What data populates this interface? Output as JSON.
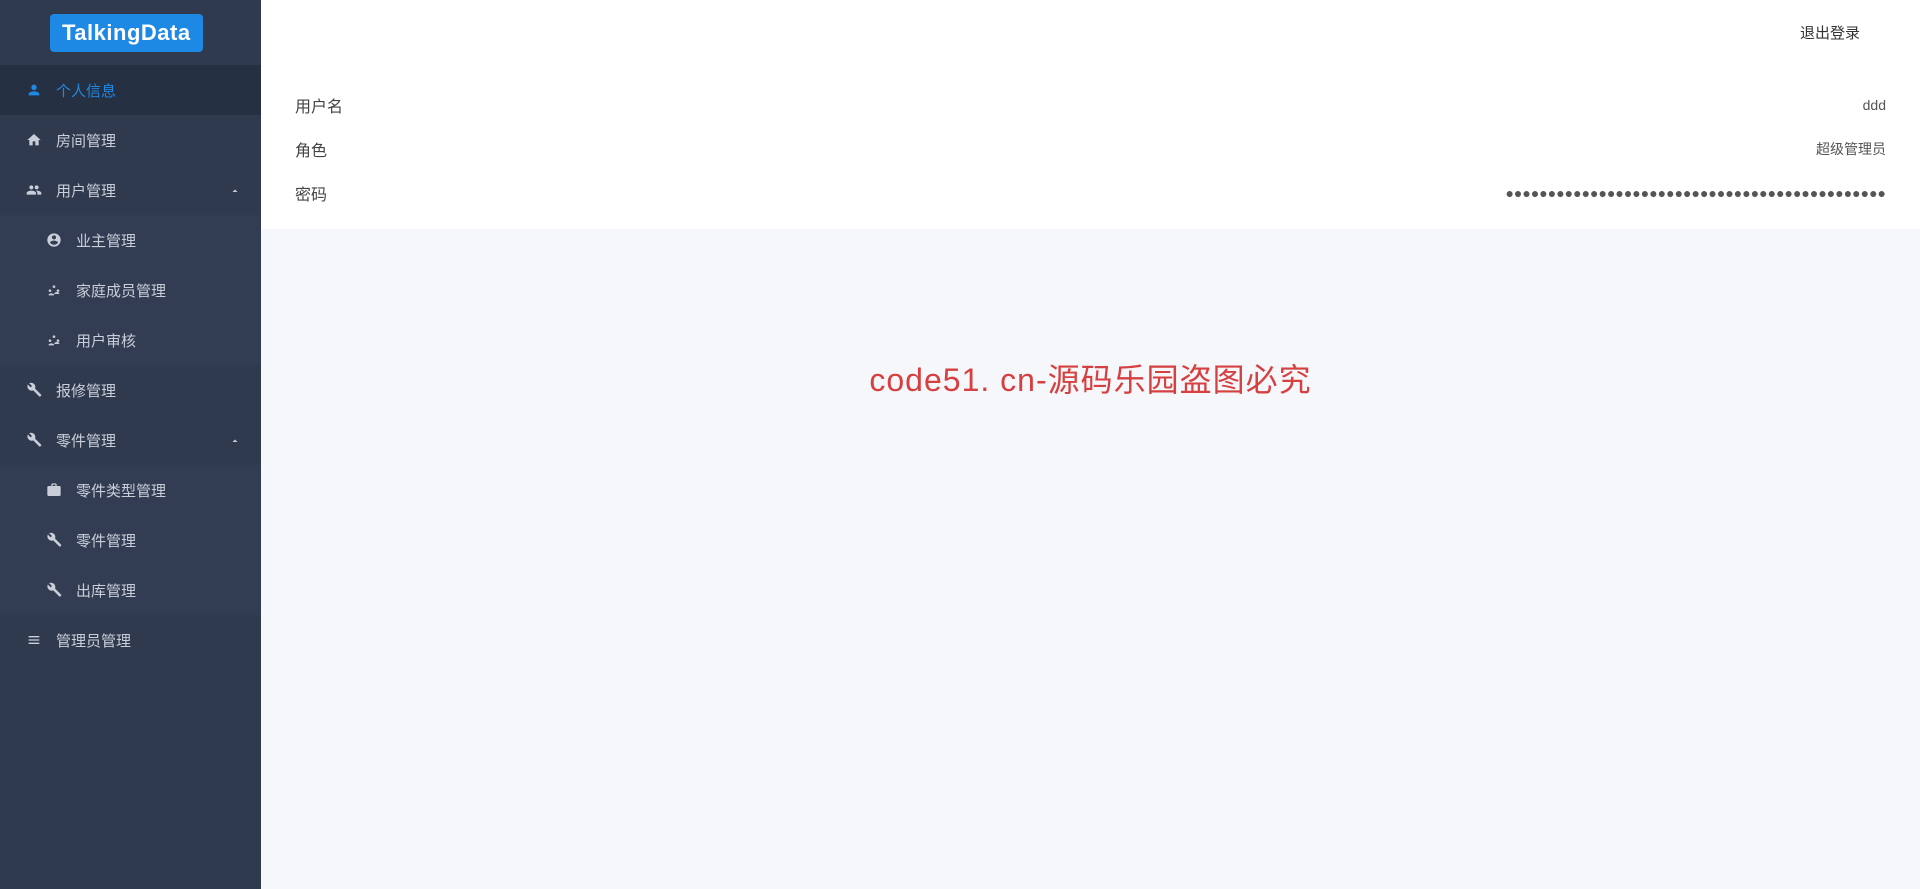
{
  "logo": "TalkingData",
  "topbar": {
    "logout": "退出登录"
  },
  "sidebar": {
    "items": [
      {
        "label": "个人信息"
      },
      {
        "label": "房间管理"
      },
      {
        "label": "用户管理"
      },
      {
        "label": "业主管理"
      },
      {
        "label": "家庭成员管理"
      },
      {
        "label": "用户审核"
      },
      {
        "label": "报修管理"
      },
      {
        "label": "零件管理"
      },
      {
        "label": "零件类型管理"
      },
      {
        "label": "零件管理"
      },
      {
        "label": "出库管理"
      },
      {
        "label": "管理员管理"
      }
    ]
  },
  "profile": {
    "username_label": "用户名",
    "username_value": "ddd",
    "role_label": "角色",
    "role_value": "超级管理员",
    "password_label": "密码",
    "password_value": "●●●●●●●●●●●●●●●●●●●●●●●●●●●●●●●●●●●●●●●●●●●●●"
  },
  "watermark": "code51. cn-源码乐园盗图必究"
}
